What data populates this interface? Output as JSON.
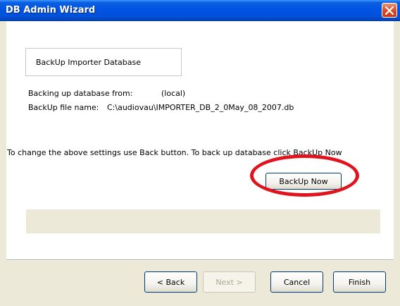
{
  "window": {
    "title": "DB Admin Wizard",
    "close_icon": "close-icon"
  },
  "step": {
    "header": "BackUp Importer Database",
    "source_label": "Backing up database from:",
    "source_value": "(local)",
    "file_label": "BackUp file name:",
    "file_value": "C:\\audiovau\\IMPORTER_DB_2_0May_08_2007.db",
    "instruction": "To change the above settings use Back button. To back up database click BackUp Now",
    "backup_button": "BackUp Now",
    "progress_fraction": 0
  },
  "footer": {
    "back": "< Back",
    "next": "Next >",
    "cancel": "Cancel",
    "finish": "Finish"
  },
  "colors": {
    "highlight": "#e0141e",
    "titlebar": "#0054e3"
  }
}
